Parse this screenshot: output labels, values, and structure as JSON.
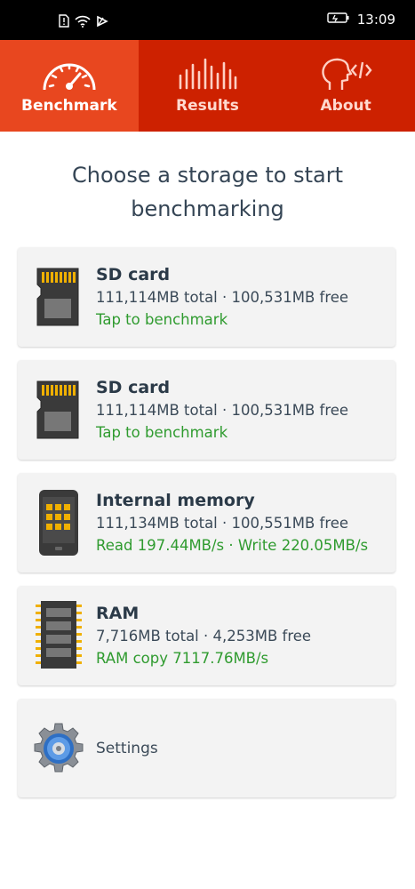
{
  "status_bar": {
    "time": "13:09",
    "icons": [
      "sim-alert-icon",
      "wifi-icon",
      "signal-icon",
      "battery-charging-icon"
    ]
  },
  "tabs": [
    {
      "label": "Benchmark",
      "icon": "speedometer-icon",
      "active": true
    },
    {
      "label": "Results",
      "icon": "bar-chart-icon",
      "active": false
    },
    {
      "label": "About",
      "icon": "head-code-icon",
      "active": false
    }
  ],
  "heading": {
    "line1": "Choose a storage to start",
    "line2": "benchmarking"
  },
  "cards": [
    {
      "icon": "sd-card-icon",
      "title": "SD card",
      "info": "111,114MB total · 100,531MB free",
      "action": "Tap to benchmark"
    },
    {
      "icon": "sd-card-icon",
      "title": "SD card",
      "info": "111,114MB total · 100,531MB free",
      "action": "Tap to benchmark"
    },
    {
      "icon": "phone-icon",
      "title": "Internal memory",
      "info": "111,134MB total · 100,551MB free",
      "action": "Read 197.44MB/s · Write 220.05MB/s"
    },
    {
      "icon": "ram-chip-icon",
      "title": "RAM",
      "info": "7,716MB total · 4,253MB free",
      "action": "RAM copy 7117.76MB/s"
    }
  ],
  "settings": {
    "icon": "gear-icon",
    "label": "Settings"
  },
  "colors": {
    "tab_active": "#e8471f",
    "tab_bar": "#cd2100",
    "action_green": "#2f9b2f",
    "card_bg": "#f3f3f3",
    "heading": "#354555"
  }
}
